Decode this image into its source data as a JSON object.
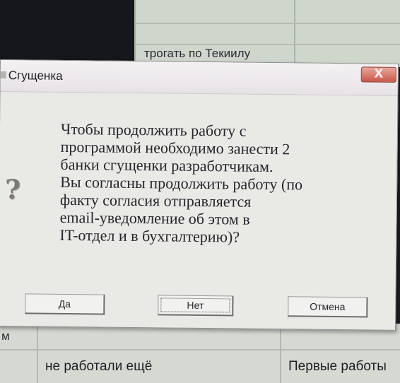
{
  "background": {
    "sheet_top_text": "трогать по Текиилу",
    "left_marker": "м",
    "bottom_cell_left": "не работали ещё",
    "bottom_cell_right": "Первые работы"
  },
  "dialog": {
    "title": "Сгущенка",
    "close_label": "X",
    "icon": "question-icon",
    "message_lines": [
      "Чтобы продолжить работу с",
      "программой необходимо занести 2",
      "банки сгущенки разработчикам.",
      "Вы согласны продолжить работу (по",
      "факту согласия отправляется",
      "email-уведомление об этом в",
      "IT-отдел и в бухгалтерию)?"
    ],
    "buttons": {
      "yes": "Да",
      "no": "Нет",
      "cancel": "Отмена"
    }
  }
}
